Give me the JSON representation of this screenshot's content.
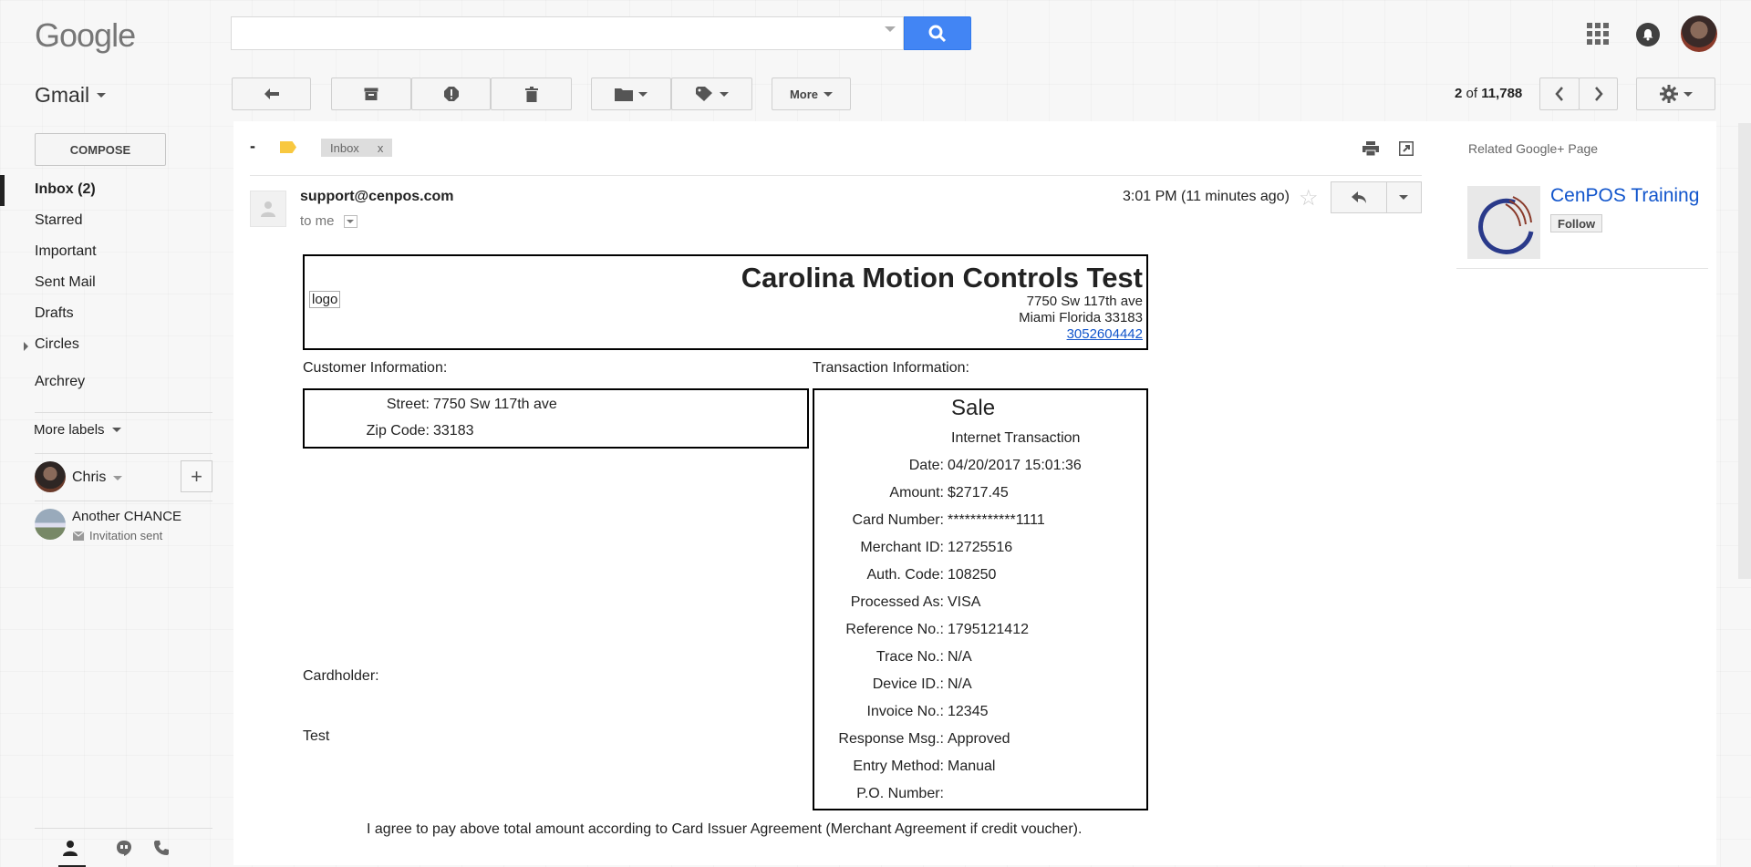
{
  "header": {
    "logo": "Google",
    "search_placeholder": ""
  },
  "toolbar": {
    "gmail_label": "Gmail",
    "more_label": "More",
    "counter_current": "2",
    "counter_of": "of",
    "counter_total": "11,788"
  },
  "sidebar": {
    "compose": "COMPOSE",
    "items": [
      {
        "label": "Inbox (2)"
      },
      {
        "label": "Starred"
      },
      {
        "label": "Important"
      },
      {
        "label": "Sent Mail"
      },
      {
        "label": "Drafts"
      },
      {
        "label": "Circles"
      },
      {
        "label": "Archrey"
      }
    ],
    "more_labels": "More labels",
    "chat_user": "Chris",
    "contact_name": "Another CHANCE",
    "contact_status": "Invitation sent"
  },
  "message": {
    "label_dash": "-",
    "inbox_chip": "Inbox",
    "inbox_chip_close": "x",
    "sender": "support@cenpos.com",
    "to": "to me",
    "time": "3:01 PM (11 minutes ago)"
  },
  "receipt": {
    "logo": "logo",
    "company": "Carolina Motion Controls Test",
    "address1": "7750 Sw 117th ave",
    "address2": "Miami Florida 33183",
    "phone": "3052604442",
    "customer_label": "Customer Information:",
    "transaction_label": "Transaction Information:",
    "customer": [
      {
        "key": "Street:",
        "value": "7750 Sw 117th ave"
      },
      {
        "key": "Zip Code:",
        "value": "33183"
      }
    ],
    "sale": "Sale",
    "txn_type": "Internet Transaction",
    "transaction": [
      {
        "key": "Date:",
        "value": "04/20/2017 15:01:36"
      },
      {
        "key": "Amount:",
        "value": "$2717.45"
      },
      {
        "key": "Card Number:",
        "value": "************1111"
      },
      {
        "key": "Merchant ID:",
        "value": "12725516"
      },
      {
        "key": "Auth. Code:",
        "value": "108250"
      },
      {
        "key": "Processed As:",
        "value": "VISA"
      },
      {
        "key": "Reference No.:",
        "value": "1795121412"
      },
      {
        "key": "Trace No.:",
        "value": "N/A"
      },
      {
        "key": "Device ID.:",
        "value": "N/A"
      },
      {
        "key": "Invoice No.:",
        "value": "12345"
      },
      {
        "key": "Response Msg.:",
        "value": "Approved"
      },
      {
        "key": "Entry Method:",
        "value": "Manual"
      },
      {
        "key": "P.O. Number:",
        "value": ""
      }
    ],
    "cardholder_label": "Cardholder:",
    "signature": "Test",
    "agreement": "I agree to pay above total amount according to Card Issuer Agreement (Merchant Agreement if credit voucher)."
  },
  "related": {
    "title": "Related Google+ Page",
    "name": "CenPOS Training",
    "follow": "Follow"
  },
  "colors": {
    "search_button": "#4285f4",
    "link": "#1155cc",
    "label_tag": "#f8c840"
  }
}
